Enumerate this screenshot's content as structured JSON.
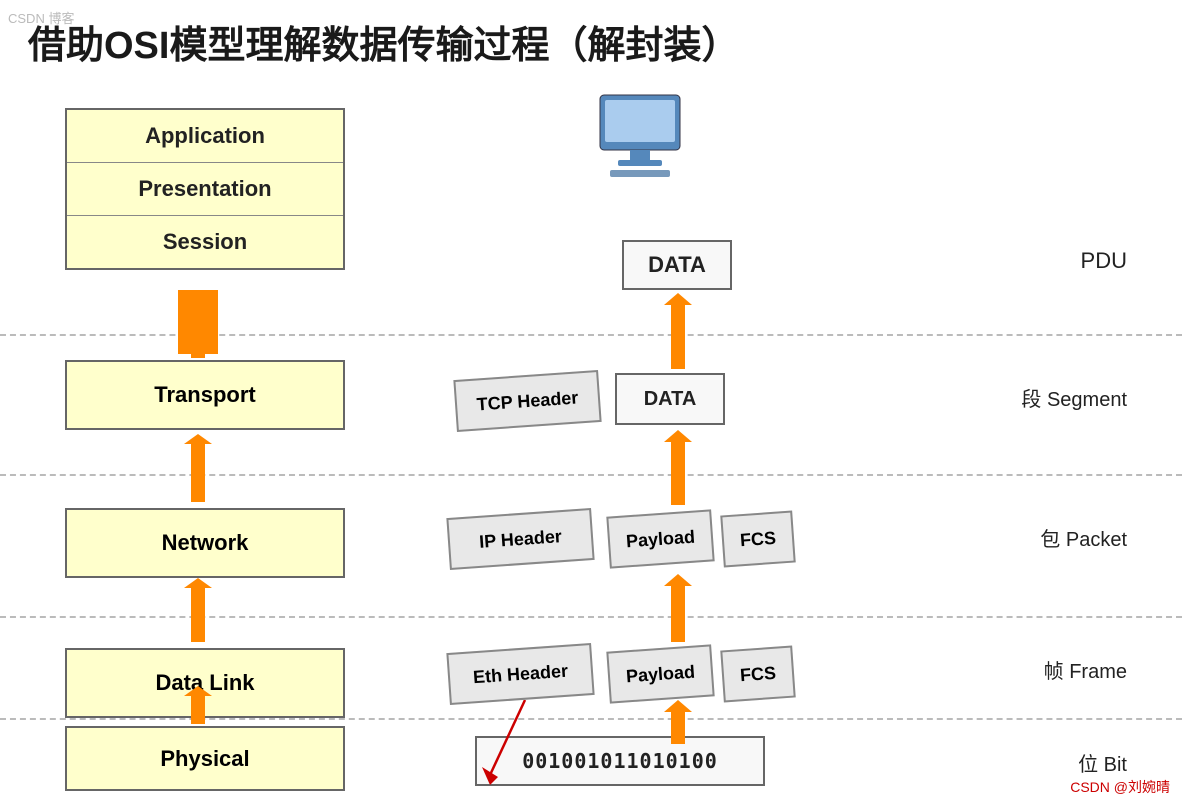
{
  "title": "借助OSI模型理解数据传输过程（解封装）",
  "watermark": "CSDN 博客",
  "csdn": "CSDN @刘婉晴",
  "layers": {
    "application": "Application",
    "presentation": "Presentation",
    "session": "Session",
    "transport": "Transport",
    "network": "Network",
    "datalink": "Data Link",
    "physical": "Physical"
  },
  "pdu": {
    "data": "DATA",
    "segment": "段 Segment",
    "packet": "包 Packet",
    "frame": "帧 Frame",
    "bit": "位 Bit",
    "pdu": "PDU"
  },
  "headers": {
    "tcp": "TCP Header",
    "ip": "IP Header",
    "eth": "Eth Header",
    "payload1": "Payload",
    "payload2": "Payload",
    "fcs1": "FCS",
    "fcs2": "FCS",
    "bits": "001001011010100"
  }
}
